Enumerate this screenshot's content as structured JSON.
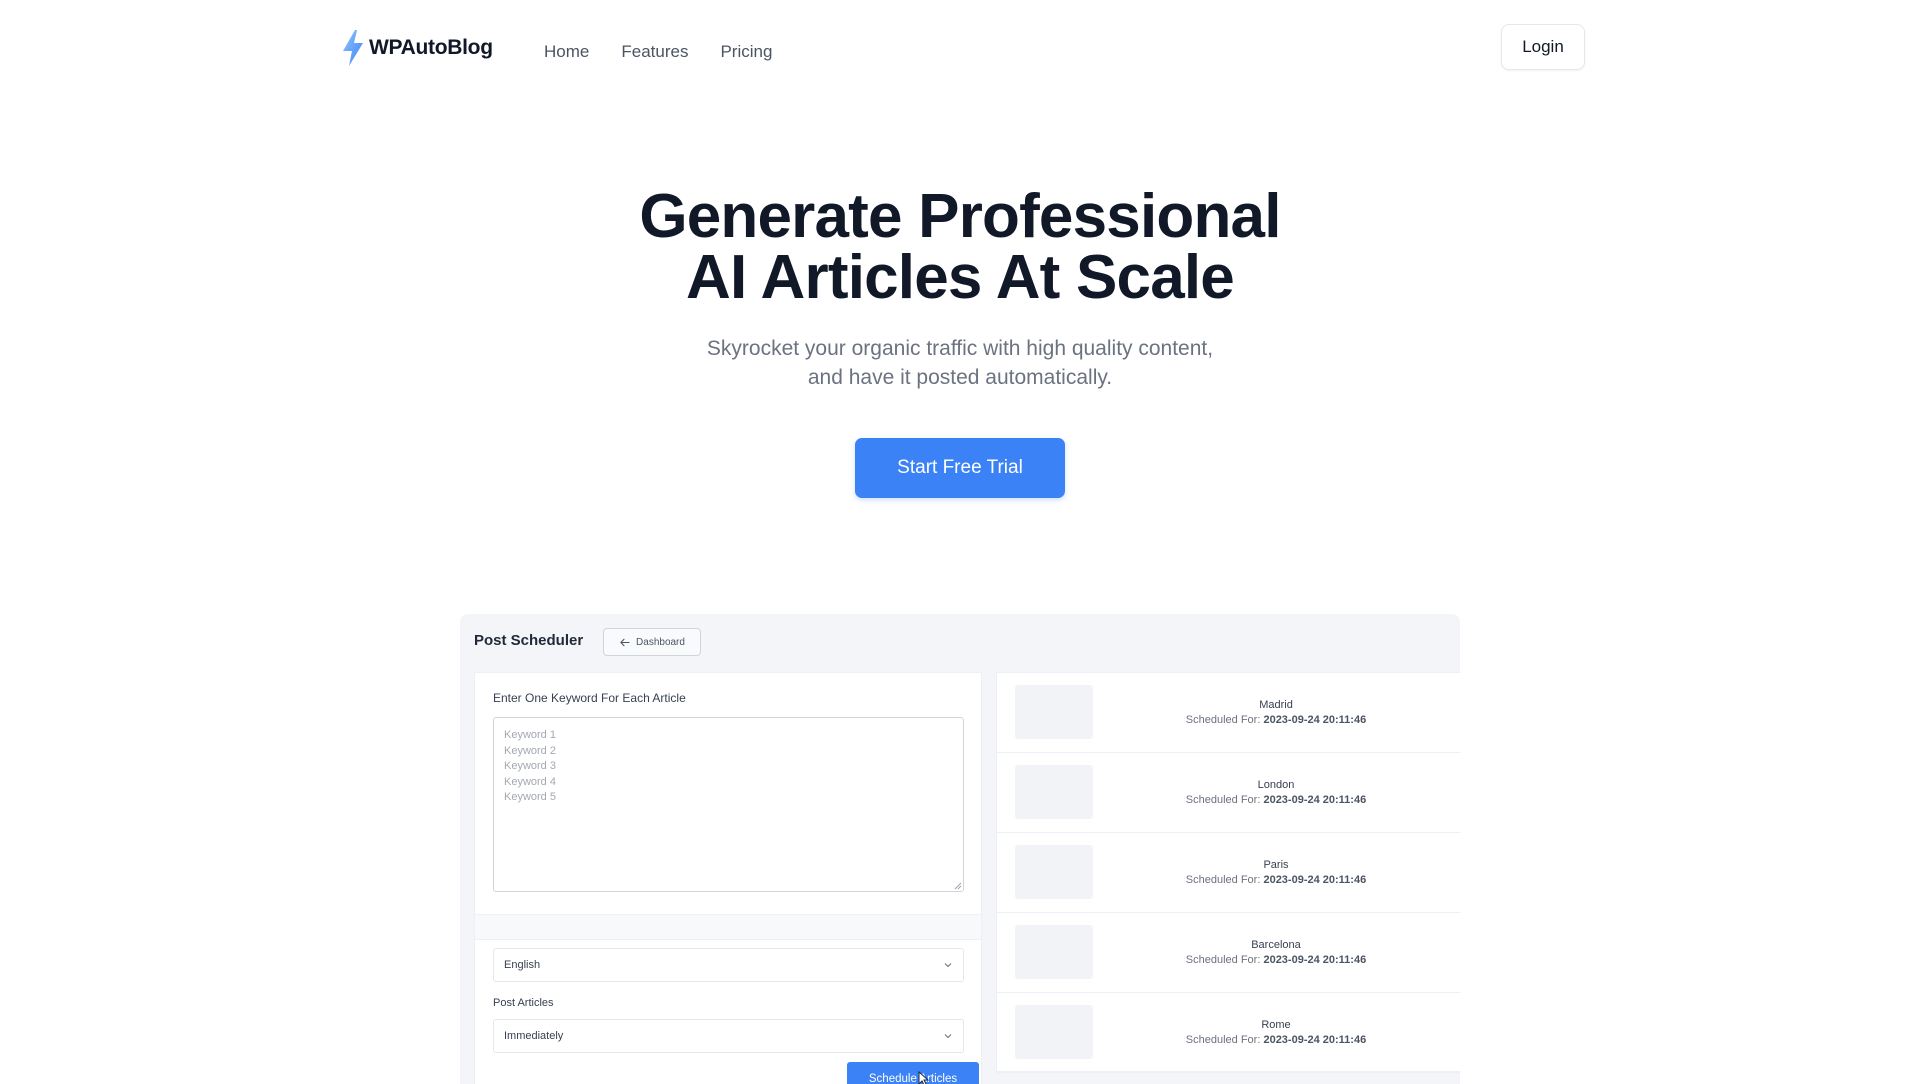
{
  "brand": {
    "name": "WPAutoBlog",
    "icon": "lightning-bolt-icon",
    "icon_color": "#60a5fa"
  },
  "nav": {
    "links": [
      "Home",
      "Features",
      "Pricing"
    ],
    "login_label": "Login"
  },
  "hero": {
    "title_line1": "Generate Professional",
    "title_line2": "AI Articles At Scale",
    "subtitle_line1": "Skyrocket your organic traffic with high quality content,",
    "subtitle_line2": "and have it posted automatically.",
    "cta_label": "Start Free Trial",
    "cta_color": "#3b82f6"
  },
  "preview": {
    "title": "Post Scheduler",
    "dashboard_button": "Dashboard",
    "keywords": {
      "label": "Enter One Keyword For Each Article",
      "placeholder": "Keyword 1\nKeyword 2\nKeyword 3\nKeyword 4\nKeyword 5"
    },
    "language": {
      "selected": "English"
    },
    "post_articles": {
      "label": "Post Articles",
      "selected": "Immediately"
    },
    "schedule_button": "Schedule Articles",
    "scheduled_prefix": "Scheduled For:",
    "scheduled": [
      {
        "city": "Madrid",
        "time": "2023-09-24 20:11:46"
      },
      {
        "city": "London",
        "time": "2023-09-24 20:11:46"
      },
      {
        "city": "Paris",
        "time": "2023-09-24 20:11:46"
      },
      {
        "city": "Barcelona",
        "time": "2023-09-24 20:11:46"
      },
      {
        "city": "Rome",
        "time": "2023-09-24 20:11:46"
      }
    ]
  }
}
